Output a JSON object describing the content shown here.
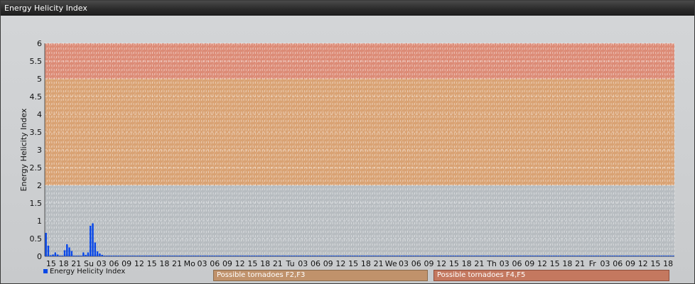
{
  "window": {
    "title": "Energy Helicity Index"
  },
  "legend": {
    "series_label": "Energy Helicity Index"
  },
  "bands": {
    "mid_label": "Possible tornadoes F2,F3",
    "high_label": "Possible tornadoes F4,F5"
  },
  "colors": {
    "bar": "#0a48e6",
    "band_low": "#b7bcc0",
    "band_mid": "#d9a273",
    "band_high": "#dc8b76"
  },
  "chart_data": {
    "type": "bar",
    "title": "",
    "xlabel": "",
    "ylabel": "Energy Helicity Index",
    "ylim": [
      0,
      6
    ],
    "yticks": [
      "0",
      "0.5",
      "1",
      "1.5",
      "2",
      "2.5",
      "3",
      "3.5",
      "4",
      "4.5",
      "5",
      "5.5",
      "6"
    ],
    "grid": true,
    "legend_position": "bottom-left",
    "shaded_bands": [
      {
        "from": 0,
        "to": 2,
        "label": ""
      },
      {
        "from": 2,
        "to": 5,
        "label": "Possible tornadoes F2,F3"
      },
      {
        "from": 5,
        "to": 6,
        "label": "Possible tornadoes F4,F5"
      }
    ],
    "categories": [
      "15",
      "18",
      "21",
      "Su",
      "03",
      "06",
      "09",
      "12",
      "15",
      "18",
      "21",
      "Mo",
      "03",
      "06",
      "09",
      "12",
      "15",
      "18",
      "21",
      "Tu",
      "03",
      "06",
      "09",
      "12",
      "15",
      "18",
      "21",
      "We",
      "03",
      "06",
      "09",
      "12",
      "15",
      "18",
      "21",
      "Th",
      "03",
      "06",
      "09",
      "12",
      "15",
      "18",
      "21",
      "Fr",
      "03",
      "06",
      "09",
      "12",
      "15",
      "18"
    ],
    "series": [
      {
        "name": "Energy Helicity Index",
        "values": [
          0.66,
          0.3,
          0.03,
          0.05,
          0.11,
          0.05,
          0.02,
          0.02,
          0.17,
          0.34,
          0.25,
          0.15,
          0.02,
          0.02,
          0.02,
          0.02,
          0.11,
          0.04,
          0.11,
          0.86,
          0.93,
          0.39,
          0.14,
          0.08,
          0.04,
          0.02,
          0.02,
          0.02,
          0.02,
          0.02,
          0.02,
          0.02,
          0.02,
          0.02,
          0.02,
          0.02,
          0.02,
          0.02,
          0.02,
          0.02,
          0.02,
          0.02,
          0.02,
          0.02,
          0.02,
          0.02,
          0.02,
          0.02,
          0.02,
          0.02,
          0.02,
          0.02,
          0.02,
          0.02,
          0.02,
          0.02,
          0.02,
          0.02,
          0.02,
          0.02,
          0.02,
          0.02,
          0.02,
          0.02,
          0.02,
          0.02,
          0.02,
          0.02,
          0.02,
          0.02,
          0.02,
          0.02,
          0.02,
          0.02,
          0.02,
          0.02,
          0.02,
          0.02,
          0.02,
          0.02,
          0.02,
          0.02,
          0.02,
          0.02,
          0.02,
          0.02,
          0.02,
          0.02,
          0.02,
          0.02,
          0.02,
          0.02,
          0.02,
          0.02,
          0.02,
          0.02,
          0.02,
          0.02,
          0.02,
          0.02,
          0.02,
          0.02,
          0.02,
          0.02,
          0.02,
          0.02,
          0.02,
          0.02,
          0.02,
          0.02,
          0.02,
          0.02,
          0.02,
          0.02,
          0.02,
          0.02,
          0.02,
          0.02,
          0.02,
          0.02,
          0.02,
          0.02,
          0.02,
          0.02,
          0.02,
          0.02,
          0.02,
          0.02,
          0.02,
          0.02,
          0.02,
          0.02,
          0.02,
          0.02,
          0.02,
          0.02,
          0.02,
          0.02,
          0.02,
          0.02,
          0.02,
          0.02,
          0.02,
          0.02,
          0.02,
          0.02,
          0.02,
          0.02,
          0.02,
          0.02,
          0.02,
          0.02,
          0.02,
          0.02,
          0.02,
          0.02,
          0.02,
          0.02,
          0.02,
          0.02,
          0.02,
          0.02,
          0.02,
          0.02,
          0.02,
          0.02,
          0.02,
          0.02,
          0.02,
          0.02,
          0.02,
          0.02,
          0.02,
          0.02,
          0.02,
          0.02,
          0.02,
          0.02,
          0.02,
          0.02,
          0.02,
          0.02,
          0.02,
          0.02,
          0.02,
          0.02,
          0.02,
          0.02,
          0.02,
          0.02,
          0.02,
          0.02,
          0.02,
          0.02,
          0.02,
          0.02,
          0.02,
          0.02,
          0.02,
          0.02,
          0.02,
          0.02,
          0.02,
          0.02,
          0.02,
          0.02,
          0.02,
          0.02,
          0.02,
          0.02,
          0.02,
          0.02,
          0.02,
          0.02,
          0.02,
          0.02,
          0.02,
          0.02,
          0.02,
          0.02,
          0.02,
          0.02,
          0.02,
          0.02,
          0.02,
          0.02,
          0.02,
          0.02,
          0.02,
          0.02,
          0.02,
          0.02,
          0.02,
          0.02,
          0.02,
          0.02,
          0.02,
          0.02,
          0.02,
          0.02,
          0.02,
          0.02,
          0.02,
          0.02,
          0.02,
          0.02,
          0.02,
          0.02,
          0.02,
          0.02,
          0.02,
          0.02,
          0.02,
          0.02,
          0.02,
          0.02,
          0.02,
          0.02,
          0.02,
          0.02,
          0.02,
          0.02,
          0.02,
          0.02,
          0.02,
          0.02,
          0.02,
          0.02,
          0.02
        ]
      }
    ]
  }
}
